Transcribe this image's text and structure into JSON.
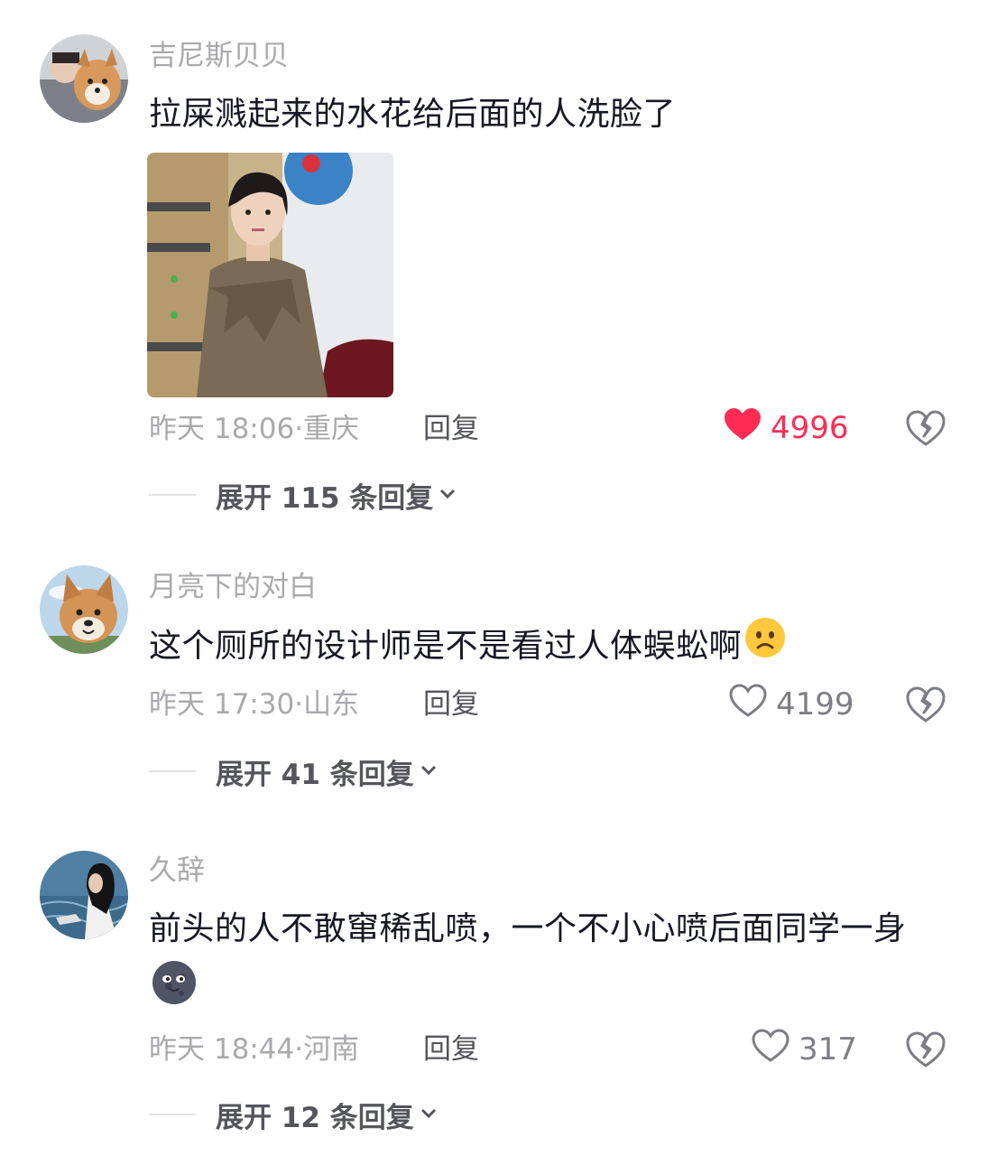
{
  "comments": [
    {
      "username": "吉尼斯贝贝",
      "text": "拉屎溅起来的水花给后面的人洗脸了",
      "emoji": "",
      "has_image": true,
      "time": "昨天 18:06",
      "location": "重庆",
      "reply_label": "回复",
      "likes": "4996",
      "liked": true,
      "expand_label": "展开 115 条回复"
    },
    {
      "username": "月亮下的对白",
      "text": "这个厕所的设计师是不是看过人体蜈蚣啊",
      "emoji": "worried-face",
      "has_image": false,
      "time": "昨天 17:30",
      "location": "山东",
      "reply_label": "回复",
      "likes": "4199",
      "liked": false,
      "expand_label": "展开 41 条回复"
    },
    {
      "username": "久辞",
      "text": "前头的人不敢窜稀乱喷，一个不小心喷后面同学一身",
      "emoji": "new-moon-face",
      "has_image": false,
      "time": "昨天 18:44",
      "location": "河南",
      "reply_label": "回复",
      "likes": "317",
      "liked": false,
      "expand_label": "展开 12 条回复"
    }
  ],
  "colors": {
    "like_active": "#fe2c55",
    "meta_gray": "#a9a9ae",
    "text_dark": "#161823"
  }
}
